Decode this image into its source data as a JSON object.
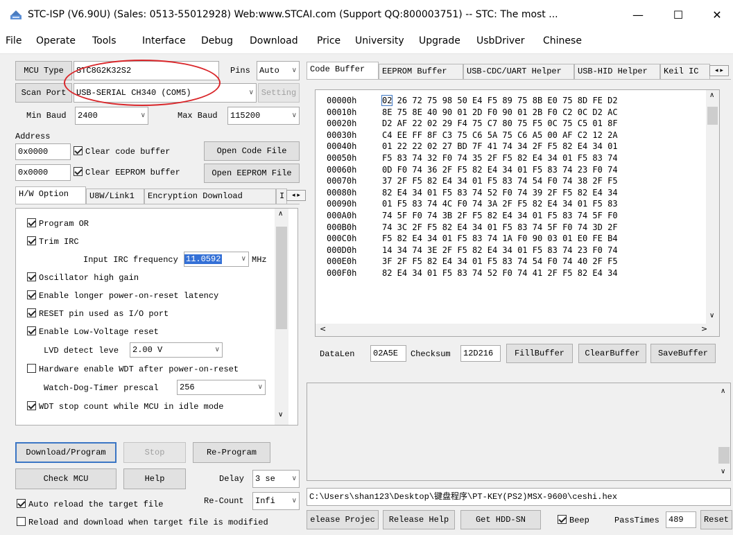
{
  "window": {
    "title": "STC-ISP (V6.90U) (Sales: 0513-55012928) Web:www.STCAI.com  (Support QQ:800003751) -- STC: The most ...",
    "minimize": "—",
    "maximize": "☐",
    "close": "✕"
  },
  "menu": [
    "File",
    "Operate",
    "Tools",
    "Interface",
    "Debug",
    "Download",
    "Price",
    "University",
    "Upgrade",
    "UsbDriver",
    "Chinese"
  ],
  "left": {
    "mcu_type_label": "MCU Type",
    "mcu_type_value": "STC8G2K32S2",
    "pins_label": "Pins",
    "pins_value": "Auto",
    "scan_port_label": "Scan Port",
    "scan_port_value": "USB-SERIAL CH340 (COM5)",
    "setting_label": "Setting",
    "min_baud_label": "Min Baud",
    "min_baud_value": "2400",
    "max_baud_label": "Max Baud",
    "max_baud_value": "115200",
    "address_label": "Address",
    "addr1_value": "0x0000",
    "clear_code_label": "Clear code buffer",
    "open_code_label": "Open Code File",
    "addr2_value": "0x0000",
    "clear_eeprom_label": "Clear EEPROM buffer",
    "open_eeprom_label": "Open EEPROM File",
    "tabs": [
      "H/W Option",
      "U8W/Link1",
      "Encryption Download",
      "I"
    ],
    "options": {
      "program_or": "Program OR",
      "trim_irc": "Trim IRC",
      "irc_label": "Input IRC frequency",
      "irc_value": "11.0592",
      "irc_unit": "MHz",
      "osc_gain": "Oscillator high gain",
      "longer_por": "Enable longer power-on-reset latency",
      "reset_io": "RESET pin used as I/O port",
      "lvr": "Enable Low-Voltage reset",
      "lvd_label": "LVD detect leve",
      "lvd_value": "2.00 V",
      "hw_wdt": "Hardware enable WDT after power-on-reset",
      "wdt_label": "Watch-Dog-Timer prescal",
      "wdt_value": "256",
      "wdt_idle": "WDT stop count while MCU in idle mode"
    },
    "download_program": "Download/Program",
    "stop": "Stop",
    "re_program": "Re-Program",
    "check_mcu": "Check MCU",
    "help": "Help",
    "delay_label": "Delay",
    "delay_value": "3 se",
    "auto_reload": "Auto reload the target file",
    "recount_label": "Re-Count",
    "recount_value": "Infi",
    "reload_modified": "Reload and download when target file is modified"
  },
  "right": {
    "tabs": [
      "Code Buffer",
      "EEPROM Buffer",
      "USB-CDC/UART Helper",
      "USB-HID Helper",
      "Keil IC"
    ],
    "hex_rows": [
      {
        "addr": "00000h",
        "bytes": "02 26 72 75 98 50 E4 F5 89 75 8B E0 75 8D FE D2"
      },
      {
        "addr": "00010h",
        "bytes": "8E 75 8E 40 90 01 2D F0 90 01 2B F0 C2 0C D2 AC"
      },
      {
        "addr": "00020h",
        "bytes": "D2 AF 22 02 29 F4 75 C7 80 75 F5 0C 75 C5 01 8F"
      },
      {
        "addr": "00030h",
        "bytes": "C4 EE FF 8F C3 75 C6 5A 75 C6 A5 00 AF C2 12 2A"
      },
      {
        "addr": "00040h",
        "bytes": "01 22 22 02 27 BD 7F 41 74 34 2F F5 82 E4 34 01"
      },
      {
        "addr": "00050h",
        "bytes": "F5 83 74 32 F0 74 35 2F F5 82 E4 34 01 F5 83 74"
      },
      {
        "addr": "00060h",
        "bytes": "0D F0 74 36 2F F5 82 E4 34 01 F5 83 74 23 F0 74"
      },
      {
        "addr": "00070h",
        "bytes": "37 2F F5 82 E4 34 01 F5 83 74 54 F0 74 38 2F F5"
      },
      {
        "addr": "00080h",
        "bytes": "82 E4 34 01 F5 83 74 52 F0 74 39 2F F5 82 E4 34"
      },
      {
        "addr": "00090h",
        "bytes": "01 F5 83 74 4C F0 74 3A 2F F5 82 E4 34 01 F5 83"
      },
      {
        "addr": "000A0h",
        "bytes": "74 5F F0 74 3B 2F F5 82 E4 34 01 F5 83 74 5F F0"
      },
      {
        "addr": "000B0h",
        "bytes": "74 3C 2F F5 82 E4 34 01 F5 83 74 5F F0 74 3D 2F"
      },
      {
        "addr": "000C0h",
        "bytes": "F5 82 E4 34 01 F5 83 74 1A F0 90 03 01 E0 FE B4"
      },
      {
        "addr": "000D0h",
        "bytes": "14 34 74 3E 2F F5 82 E4 34 01 F5 83 74 23 F0 74"
      },
      {
        "addr": "000E0h",
        "bytes": "3F 2F F5 82 E4 34 01 F5 83 74 54 F0 74 40 2F F5"
      },
      {
        "addr": "000F0h",
        "bytes": "82 E4 34 01 F5 83 74 52 F0 74 41 2F F5 82 E4 34"
      }
    ],
    "datalen_label": "DataLen",
    "datalen_value": "02A5E",
    "checksum_label": "Checksum",
    "checksum_value": "12D216",
    "fill_buffer": "FillBuffer",
    "clear_buffer": "ClearBuffer",
    "save_buffer": "SaveBuffer",
    "file_path": "C:\\Users\\shan123\\Desktop\\键盘程序\\PT-KEY(PS2)MSX-9600\\ceshi.hex",
    "release_project": "elease Projec",
    "release_help": "Release Help",
    "get_hdd_sn": "Get HDD-SN",
    "beep_label": "Beep",
    "passtimes_label": "PassTimes",
    "passtimes_value": "489",
    "reset_label": "Reset"
  }
}
